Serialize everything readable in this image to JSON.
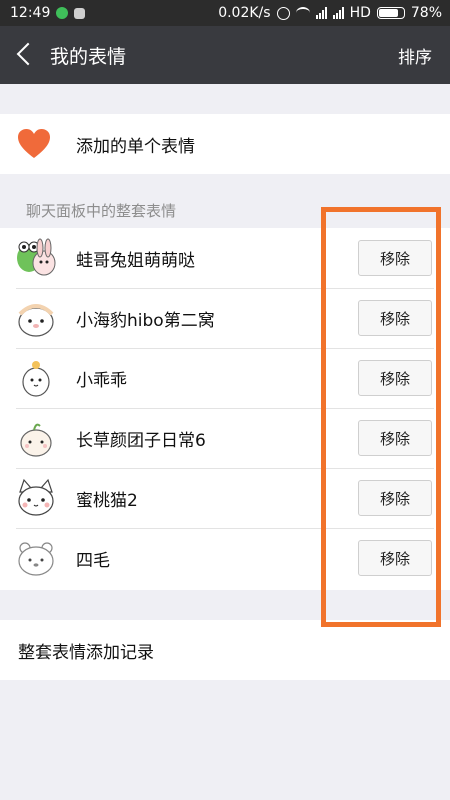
{
  "status_bar": {
    "time": "12:49",
    "speed": "0.02K/s",
    "network": "HD",
    "battery": "78%"
  },
  "header": {
    "title": "我的表情",
    "sort_label": "排序"
  },
  "single": {
    "label": "添加的单个表情",
    "icon": "heart-icon",
    "icon_color": "#f06a3a"
  },
  "section": {
    "title": "聊天面板中的整套表情"
  },
  "packs": [
    {
      "name": "蛙哥兔姐萌萌哒",
      "button": "移除",
      "icon": "frog-bunny-sticker"
    },
    {
      "name": "小海豹hibo第二窝",
      "button": "移除",
      "icon": "seal-sticker"
    },
    {
      "name": "小乖乖",
      "button": "移除",
      "icon": "chick-sticker"
    },
    {
      "name": "长草颜团子日常6",
      "button": "移除",
      "icon": "dumpling-sticker"
    },
    {
      "name": "蜜桃猫2",
      "button": "移除",
      "icon": "peach-cat-sticker"
    },
    {
      "name": "四毛",
      "button": "移除",
      "icon": "bear-sticker"
    }
  ],
  "history": {
    "label": "整套表情添加记录"
  },
  "colors": {
    "app_bar": "#393a3f",
    "highlight": "#f1732b",
    "background": "#efeff4"
  }
}
